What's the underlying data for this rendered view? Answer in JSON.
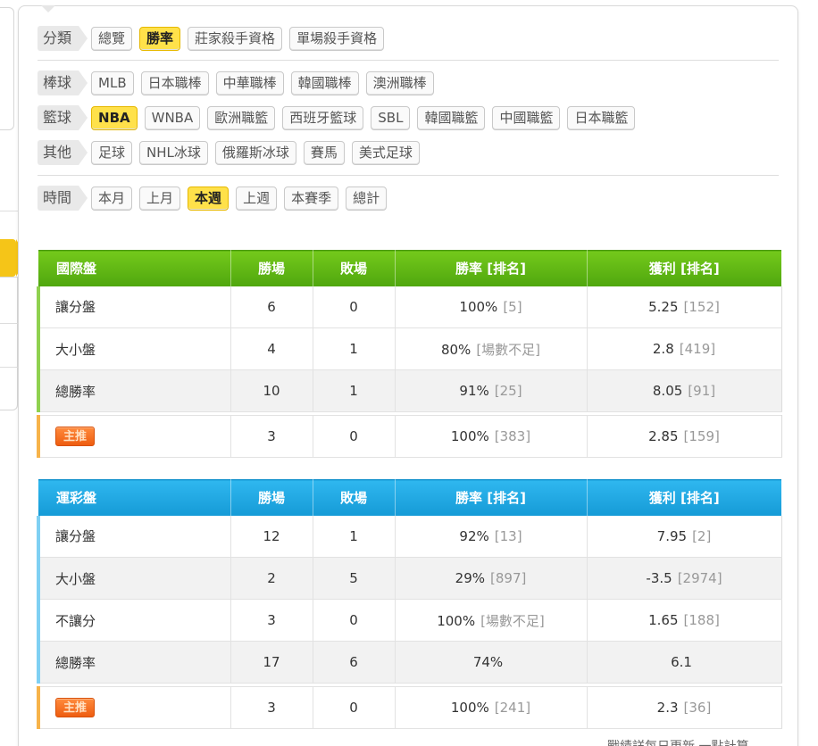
{
  "filters": {
    "category": {
      "label": "分類",
      "items": [
        "總覽",
        "勝率",
        "莊家殺手資格",
        "單場殺手資格"
      ],
      "active": 1
    },
    "baseball": {
      "label": "棒球",
      "items": [
        "MLB",
        "日本職棒",
        "中華職棒",
        "韓國職棒",
        "澳洲職棒"
      ],
      "active": -1
    },
    "basketball": {
      "label": "籃球",
      "items": [
        "NBA",
        "WNBA",
        "歐洲職籃",
        "西班牙籃球",
        "SBL",
        "韓國職籃",
        "中國職籃",
        "日本職籃"
      ],
      "active": 0
    },
    "other": {
      "label": "其他",
      "items": [
        "足球",
        "NHL冰球",
        "俄羅斯冰球",
        "賽馬",
        "美式足球"
      ],
      "active": -1
    },
    "time": {
      "label": "時間",
      "items": [
        "本月",
        "上月",
        "本週",
        "上週",
        "本賽季",
        "總計"
      ],
      "active": 2
    }
  },
  "international": {
    "headers": [
      "國際盤",
      "勝場",
      "敗場",
      "勝率 [排名]",
      "獲利 [排名]"
    ],
    "rows": [
      {
        "name": "讓分盤",
        "wins": "6",
        "losses": "0",
        "rate": "100%",
        "rate_rank": "[5]",
        "profit": "5.25",
        "profit_rank": "[152]"
      },
      {
        "name": "大小盤",
        "wins": "4",
        "losses": "1",
        "rate": "80%",
        "rate_rank": "[場數不足]",
        "profit": "2.8",
        "profit_rank": "[419]"
      },
      {
        "name": "總勝率",
        "wins": "10",
        "losses": "1",
        "rate": "91%",
        "rate_rank": "[25]",
        "profit": "8.05",
        "profit_rank": "[91]"
      }
    ],
    "pick": {
      "badge": "主推",
      "wins": "3",
      "losses": "0",
      "rate": "100%",
      "rate_rank": "[383]",
      "profit": "2.85",
      "profit_rank": "[159]"
    }
  },
  "lottery": {
    "headers": [
      "運彩盤",
      "勝場",
      "敗場",
      "勝率 [排名]",
      "獲利 [排名]"
    ],
    "rows": [
      {
        "name": "讓分盤",
        "wins": "12",
        "losses": "1",
        "rate": "92%",
        "rate_rank": "[13]",
        "profit": "7.95",
        "profit_rank": "[2]"
      },
      {
        "name": "大小盤",
        "wins": "2",
        "losses": "5",
        "rate": "29%",
        "rate_rank": "[897]",
        "profit": "-3.5",
        "profit_rank": "[2974]"
      },
      {
        "name": "不讓分",
        "wins": "3",
        "losses": "0",
        "rate": "100%",
        "rate_rank": "[場數不足]",
        "profit": "1.65",
        "profit_rank": "[188]"
      },
      {
        "name": "總勝率",
        "wins": "17",
        "losses": "6",
        "rate": "74%",
        "rate_rank": "",
        "profit": "6.1",
        "profit_rank": ""
      }
    ],
    "pick": {
      "badge": "主推",
      "wins": "3",
      "losses": "0",
      "rate": "100%",
      "rate_rank": "[241]",
      "profit": "2.3",
      "profit_rank": "[36]"
    }
  },
  "footnote": "戰績詳每日更新 一點計算"
}
